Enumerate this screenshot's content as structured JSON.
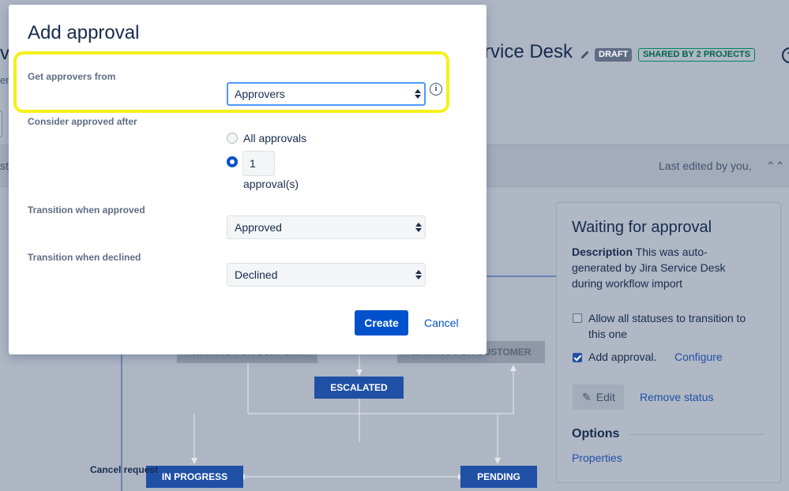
{
  "background": {
    "project_title_fragment": "rvice Desk",
    "title_left_fragment": "v",
    "subtitle_left_fragment": "erv",
    "tab_left_fragment": "st",
    "status_draft": "DRAFT",
    "status_shared": "SHARED BY 2 PROJECTS",
    "help_glyph": "?",
    "last_edited": "Last edited by you,",
    "collapse_glyph": "⌃⌃",
    "diagram": {
      "nodes": {
        "waiting_for_support": "WAITING FOR SUPPORT",
        "waiting_for_customer": "WAITING FOR CUSTOMER",
        "escalated": "ESCALATED",
        "in_progress": "IN PROGRESS",
        "pending": "PENDING"
      },
      "transition_label": "Cancel request"
    },
    "side_panel": {
      "title": "Waiting for approval",
      "description_label": "Description",
      "description_text": "This was auto-generated by Jira Service Desk during workflow import",
      "allow_all": "Allow all statuses to transition to this one",
      "add_approval": "Add approval.",
      "configure_link": "Configure",
      "edit_button": "Edit",
      "remove_status": "Remove status",
      "options_heading": "Options",
      "properties_link": "Properties"
    }
  },
  "modal": {
    "title": "Add approval",
    "get_approvers_label": "Get approvers from",
    "get_approvers_value": "Approvers",
    "consider_label": "Consider approved after",
    "radio_all": "All approvals",
    "radio_count_value": "1",
    "radio_count_suffix": "approval(s)",
    "transition_approved_label": "Transition when approved",
    "transition_approved_value": "Approved",
    "transition_declined_label": "Transition when declined",
    "transition_declined_value": "Declined",
    "create_button": "Create",
    "cancel_button": "Cancel"
  },
  "colors": {
    "primary": "#0052cc",
    "highlight": "#f5f01a",
    "focus_ring": "#4c9aff",
    "lozenge_draft": "#5e6c84",
    "lozenge_shared": "#00875a"
  },
  "icons": {
    "info": "info-icon",
    "pencil": "pencil-icon",
    "select_arrows": "select-arrows-icon",
    "help": "help-icon"
  }
}
